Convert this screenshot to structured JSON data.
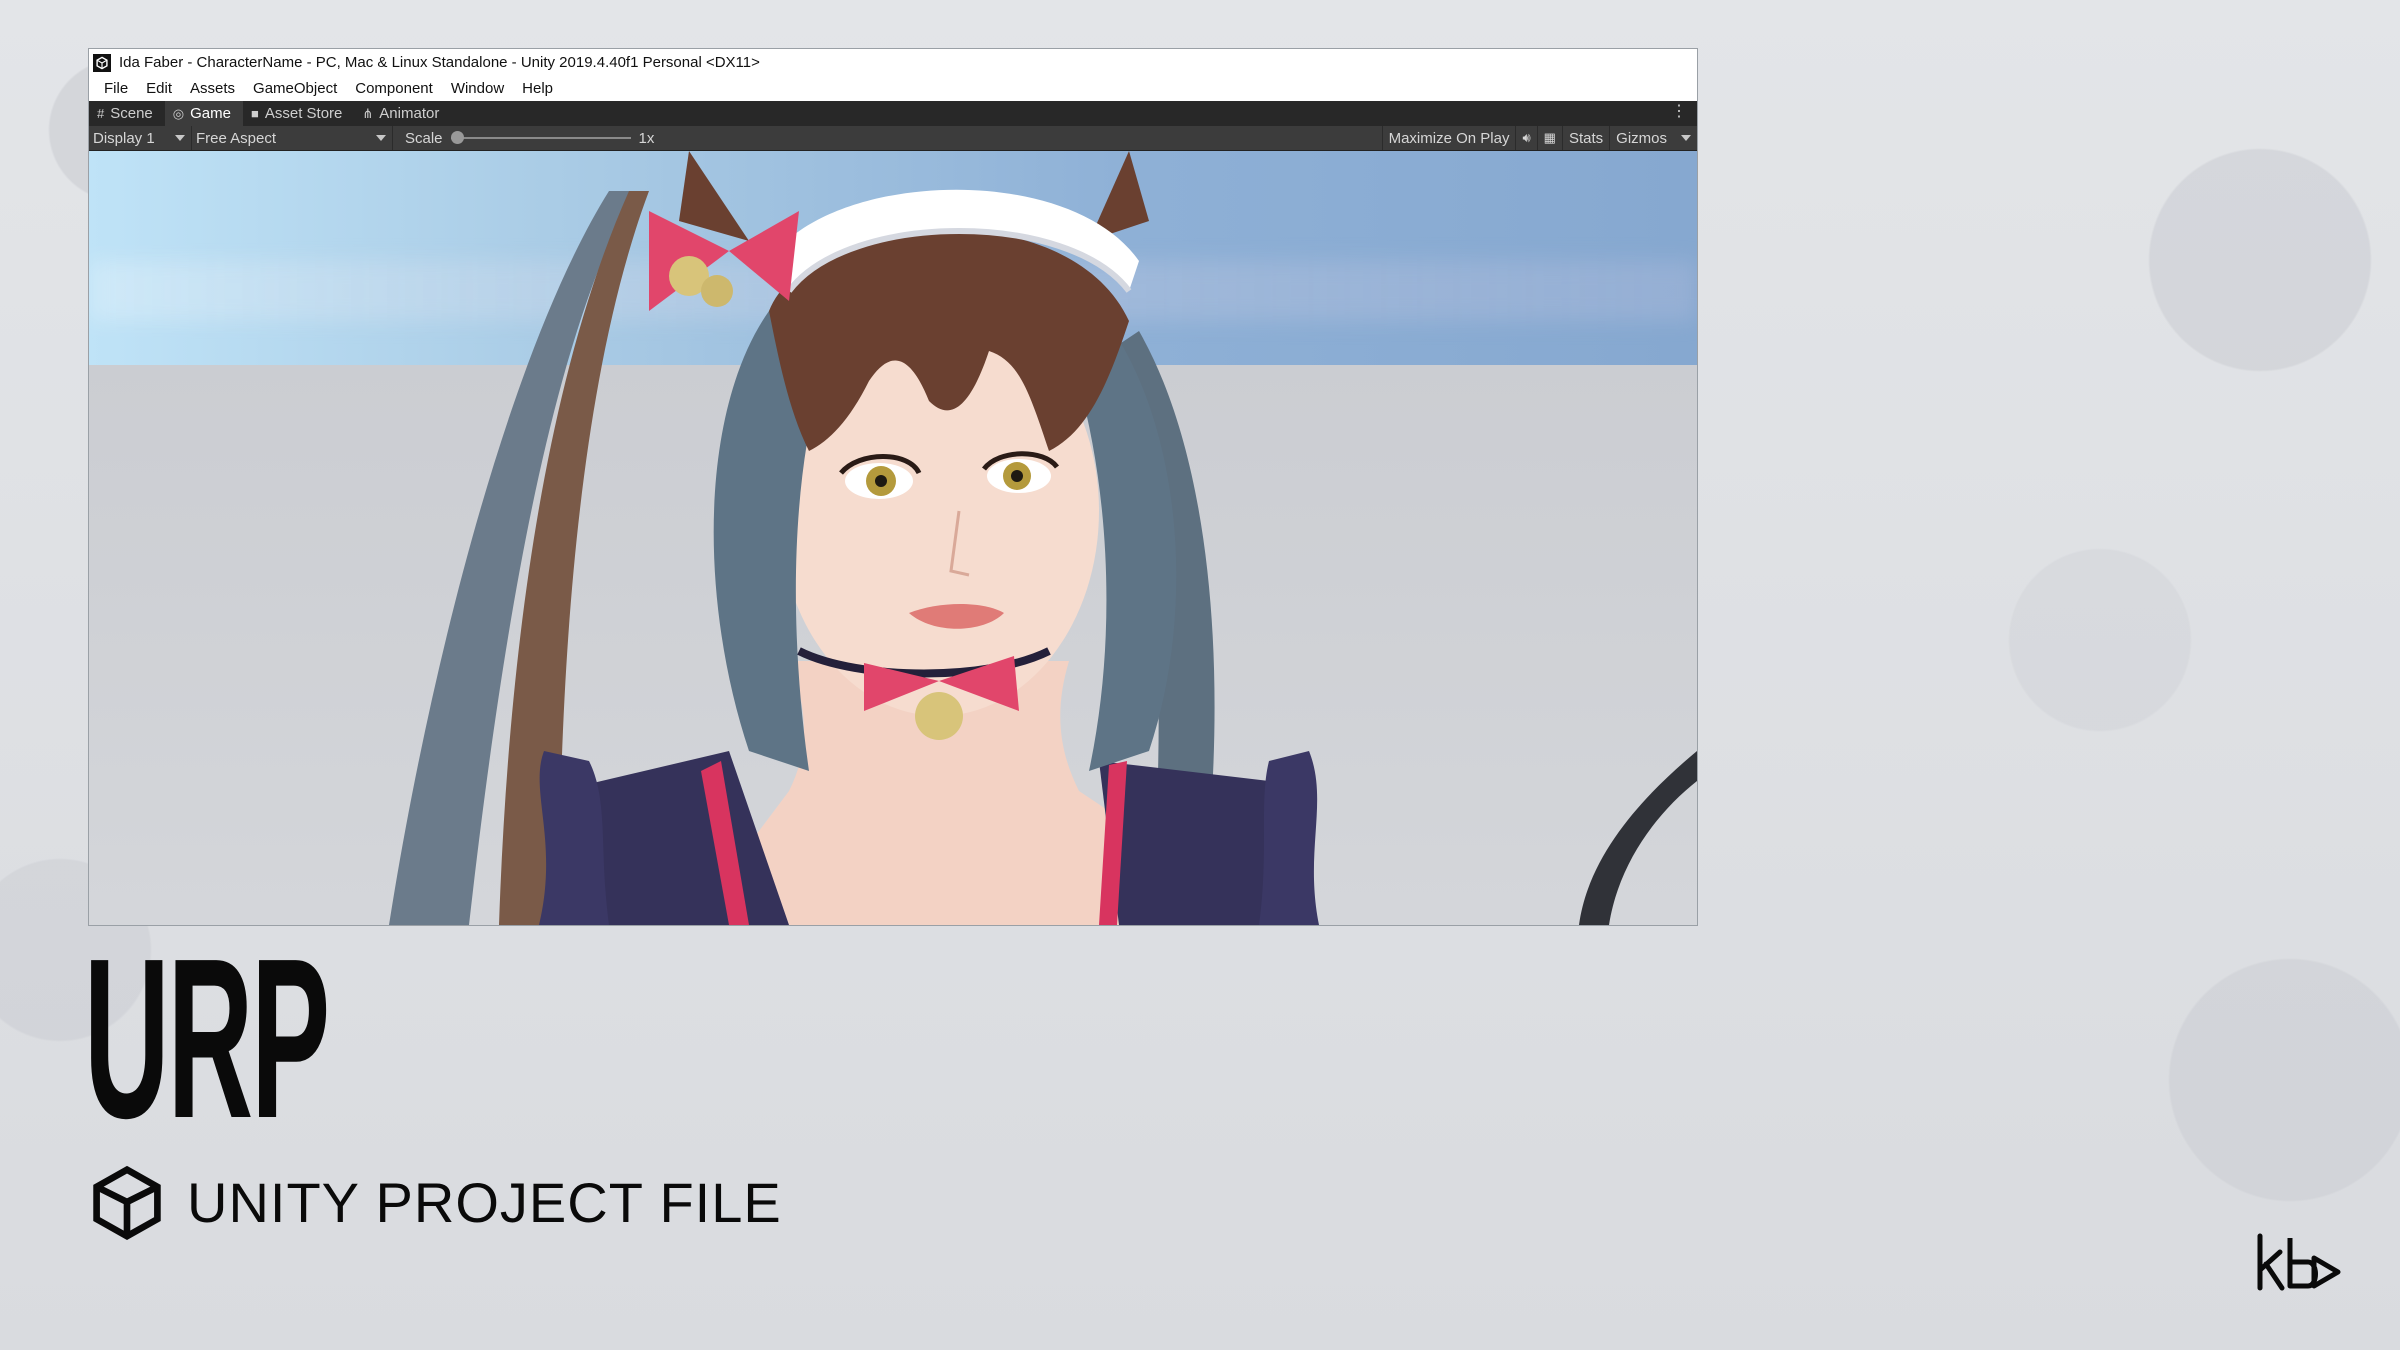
{
  "window": {
    "title": "Ida Faber - CharacterName - PC, Mac & Linux Standalone - Unity 2019.4.40f1 Personal <DX11>"
  },
  "menu": [
    "File",
    "Edit",
    "Assets",
    "GameObject",
    "Component",
    "Window",
    "Help"
  ],
  "tabs": [
    {
      "label": "Scene",
      "icon": "grid-icon"
    },
    {
      "label": "Game",
      "icon": "gamepad-icon",
      "active": true
    },
    {
      "label": "Asset Store",
      "icon": "bag-icon"
    },
    {
      "label": "Animator",
      "icon": "animator-icon"
    }
  ],
  "toolbar": {
    "display": "Display 1",
    "aspect": "Free Aspect",
    "scale_label": "Scale",
    "scale_value": "1x",
    "maximize": "Maximize On Play",
    "stats": "Stats",
    "gizmos": "Gizmos"
  },
  "slide": {
    "title": "URP",
    "subtitle": "UNITY PROJECT FILE"
  },
  "colors": {
    "background": "#dfe1e5",
    "tab_bar": "#282828",
    "toolbar": "#3c3c3c",
    "text_dark": "#0a0a0a",
    "bow_pink": "#e1466b",
    "hair_brown": "#6a4030",
    "hair_blue": "#5e7486"
  }
}
